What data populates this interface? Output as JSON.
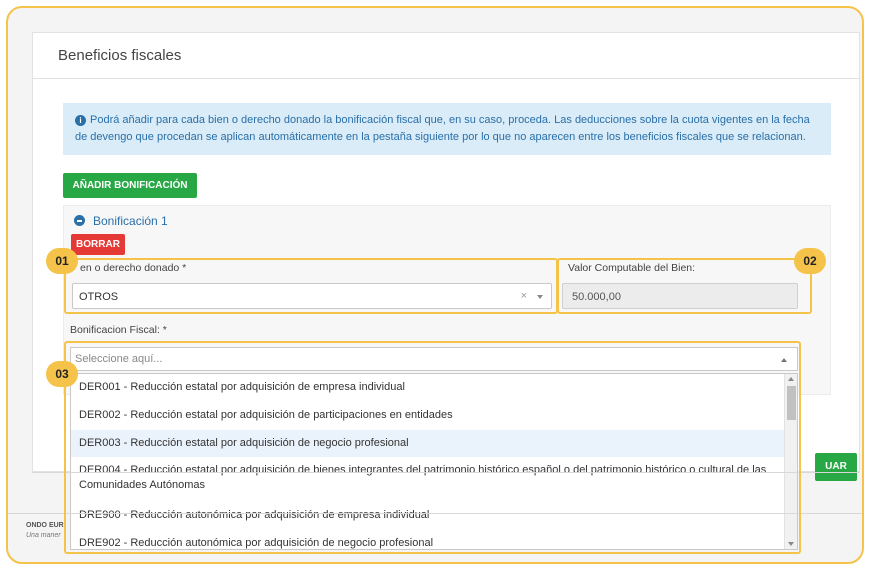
{
  "page": {
    "title": "Beneficios fiscales"
  },
  "info": {
    "icon": "info-icon",
    "text": "Podrá añadir para cada bien o derecho donado la bonificación fiscal que, en su caso, proceda. Las deducciones sobre la cuota vigentes en la fecha de devengo que procedan se aplican automáticamente en la pestaña siguiente por lo que no aparecen entre los beneficios fiscales que se relacionan."
  },
  "toolbar": {
    "add_label": "AÑADIR BONIFICACIÓN",
    "continue_label": "UAR"
  },
  "bonificacion": {
    "header": "Bonificación 1",
    "delete_label": "BORRAR",
    "bien_label": "en o derecho donado *",
    "bien_value": "OTROS",
    "clear_symbol": "×",
    "valor_label": "Valor Computable del Bien:",
    "valor_value": "50.000,00",
    "boni_label": "Bonificacion Fiscal: *",
    "boni_placeholder": "Seleccione aquí..."
  },
  "options": [
    "DER001 - Reducción estatal por adquisición de empresa individual",
    "DER002 - Reducción estatal por adquisición de participaciones en entidades",
    "DER003 - Reducción estatal por adquisición de negocio profesional",
    "DER004 - Reducción estatal por adquisición de bienes integrantes del patrimonio histórico español o del patrimonio histórico o cultural de las Comunidades Autónomas",
    "DRE900 - Reducción autonómica por adquisición de empresa individual",
    "DRE902 - Reducción autonómica por adquisición de negocio profesional"
  ],
  "footer": {
    "line1": "ONDO EUR",
    "line2": "Una maner"
  },
  "callouts": [
    "01",
    "02",
    "03"
  ],
  "colors": {
    "accent": "#f5c34a",
    "primary": "#2a6fa8",
    "success": "#27a844",
    "danger": "#e53935"
  }
}
